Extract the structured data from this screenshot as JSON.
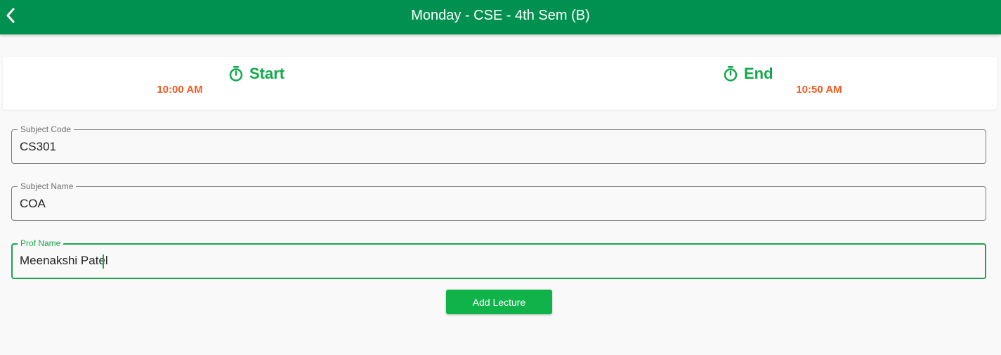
{
  "appbar": {
    "title": "Monday - CSE - 4th Sem (B)",
    "back_icon": "chevron-left-icon",
    "bg_color": "#009150"
  },
  "timing": {
    "start": {
      "label": "Start",
      "time": "10:00 AM",
      "icon": "stopwatch-icon"
    },
    "end": {
      "label": "End",
      "time": "10:50 AM",
      "icon": "stopwatch-icon"
    },
    "label_color": "#11a84b",
    "time_color": "#f15a22"
  },
  "form": {
    "subject_code": {
      "label": "Subject Code",
      "value": "CS301"
    },
    "subject_name": {
      "label": "Subject Name",
      "value": "COA"
    },
    "prof_name": {
      "label": "Prof Name",
      "value": "Meenakshi Patel",
      "focused": true
    }
  },
  "actions": {
    "add_lecture_label": "Add Lecture",
    "accent_color": "#0fb34a"
  }
}
